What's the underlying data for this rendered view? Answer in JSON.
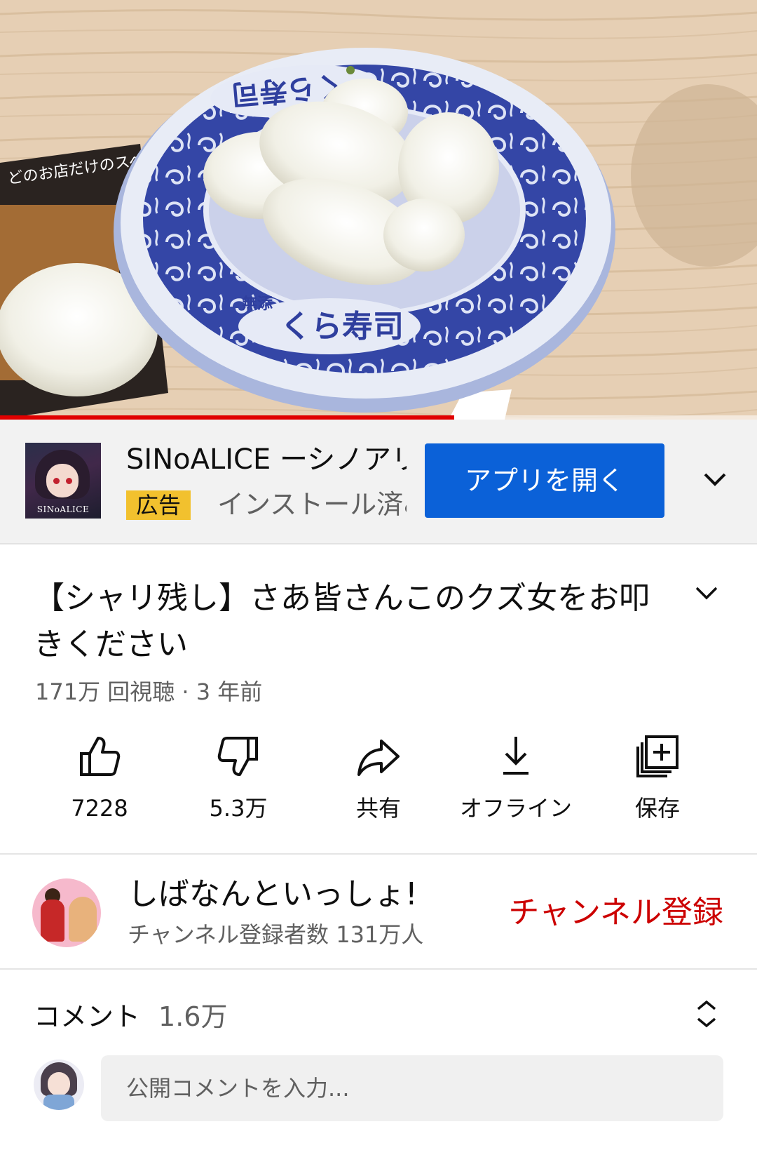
{
  "video": {
    "progress": 0.6,
    "plate_text_top": "くら寿司",
    "plate_text_bottom": "くら寿司",
    "plate_small_text": "無添",
    "menu_text": "どのお店だけのスペシャル味わえる!"
  },
  "ad": {
    "title": "SINoALICE ーシノアリスー",
    "badge": "広告",
    "subtitle": "インストール済み",
    "thumb_label": "SINoALICE",
    "button": "アプリを開く",
    "chevron": "chevron-down-icon"
  },
  "title": {
    "text": "【シャリ残し】さあ皆さんこのクズ女をお叩きください",
    "meta": "171万 回視聴 · 3 年前"
  },
  "actions": [
    {
      "icon": "like-icon",
      "label": "7228"
    },
    {
      "icon": "dislike-icon",
      "label": "5.3万"
    },
    {
      "icon": "share-icon",
      "label": "共有"
    },
    {
      "icon": "download-icon",
      "label": "オフライン"
    },
    {
      "icon": "save-to-playlist-icon",
      "label": "保存"
    }
  ],
  "channel": {
    "name": "しばなんといっしょ!",
    "subs": "チャンネル登録者数 131万人",
    "subscribe": "チャンネル登録"
  },
  "comments": {
    "label": "コメント",
    "count": "1.6万",
    "placeholder": "公開コメントを入力..."
  },
  "colors": {
    "accent_red": "#cc0000",
    "progress_red": "#e00000",
    "button_blue": "#0b61d8",
    "ad_badge_yellow": "#f2c12e",
    "plate_blue": "#2f3f9e"
  }
}
